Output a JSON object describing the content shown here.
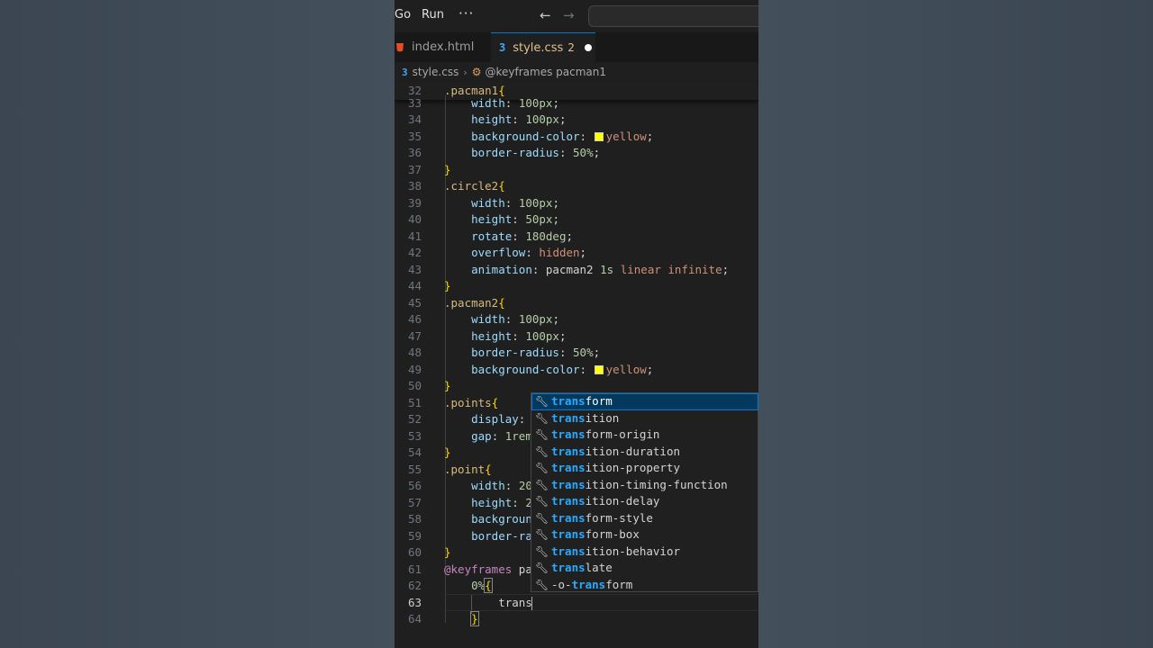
{
  "menu": {
    "go": "Go",
    "run": "Run",
    "more": "···"
  },
  "nav": {
    "back": "←",
    "forward": "→"
  },
  "tabs": [
    {
      "label": "index.html",
      "icon": "html5-icon"
    },
    {
      "label": "style.css",
      "problems": "2",
      "icon": "css3-icon"
    }
  ],
  "breadcrumb": {
    "file": "style.css",
    "symbol": "@keyframes pacman1"
  },
  "line_numbers": [
    "32",
    "33",
    "34",
    "35",
    "36",
    "37",
    "38",
    "39",
    "40",
    "41",
    "42",
    "43",
    "44",
    "45",
    "46",
    "47",
    "48",
    "49",
    "50",
    "51",
    "52",
    "53",
    "54",
    "55",
    "56",
    "57",
    "58",
    "59",
    "60",
    "61",
    "62",
    "63",
    "64"
  ],
  "code": {
    "l32": {
      "sel": ".pacman1",
      "brace": "{"
    },
    "l33": {
      "prop": "width",
      "num": "100px"
    },
    "l34": {
      "prop": "height",
      "num": "100px"
    },
    "l35": {
      "prop": "background-color",
      "val": "yellow"
    },
    "l36": {
      "prop": "border-radius",
      "num": "50%"
    },
    "l37": {
      "brace": "}"
    },
    "l38": {
      "sel": ".circle2",
      "brace": "{"
    },
    "l39": {
      "prop": "width",
      "num": "100px"
    },
    "l40": {
      "prop": "height",
      "num": "50px"
    },
    "l41": {
      "prop": "rotate",
      "num": "180deg"
    },
    "l42": {
      "prop": "overflow",
      "val": "hidden"
    },
    "l43": {
      "prop": "animation",
      "name": "pacman2",
      "dur": "1s",
      "rest": "linear infinite"
    },
    "l44": {
      "brace": "}"
    },
    "l45": {
      "sel": ".pacman2",
      "brace": "{"
    },
    "l46": {
      "prop": "width",
      "num": "100px"
    },
    "l47": {
      "prop": "height",
      "num": "100px"
    },
    "l48": {
      "prop": "border-radius",
      "num": "50%"
    },
    "l49": {
      "prop": "background-color",
      "val": "yellow"
    },
    "l50": {
      "brace": "}"
    },
    "l51": {
      "sel": ".points",
      "brace": "{"
    },
    "l52": {
      "prop": "display"
    },
    "l53": {
      "prop": "gap",
      "num": "1rem"
    },
    "l54": {
      "brace": "}"
    },
    "l55": {
      "sel": ".point",
      "brace": "{"
    },
    "l56": {
      "prop": "width",
      "num": "20"
    },
    "l57": {
      "prop": "height",
      "num": "2"
    },
    "l58": {
      "prop": "backgroun"
    },
    "l59": {
      "prop": "border-ra"
    },
    "l60": {
      "brace": "}"
    },
    "l61": {
      "kw": "@keyframes",
      "name": "pa"
    },
    "l62": {
      "num": "0%",
      "brace": "{"
    },
    "l63": {
      "typed": "trans"
    },
    "l64": {
      "brace": "}"
    }
  },
  "suggestions": [
    {
      "match": "trans",
      "rest": "form"
    },
    {
      "match": "trans",
      "rest": "ition"
    },
    {
      "match": "trans",
      "rest": "form-origin"
    },
    {
      "match": "trans",
      "rest": "ition-duration"
    },
    {
      "match": "trans",
      "rest": "ition-property"
    },
    {
      "match": "trans",
      "rest": "ition-timing-function"
    },
    {
      "match": "trans",
      "rest": "ition-delay"
    },
    {
      "match": "trans",
      "rest": "form-style"
    },
    {
      "match": "trans",
      "rest": "form-box"
    },
    {
      "match": "trans",
      "rest": "ition-behavior"
    },
    {
      "match": "trans",
      "rest": "late"
    },
    {
      "pre": "-o-",
      "match": "trans",
      "rest": "form"
    }
  ],
  "colors": {
    "swatch": "#ffff00",
    "accent": "#0078d4",
    "match": "#2aaaff"
  }
}
